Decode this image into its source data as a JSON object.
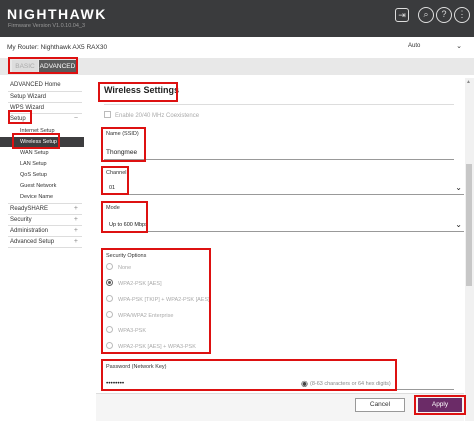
{
  "header": {
    "brand": "NIGHTHAWK",
    "firmware": "Firmware Version V1.0.10.04_3",
    "icons": [
      "logout-icon",
      "search-icon",
      "help-icon",
      "menu-icon"
    ],
    "bg_color": "#3a3b3d"
  },
  "router_bar": {
    "my_router": "My Router: Nighthawk AX5 RAX30",
    "language": "Auto"
  },
  "tabs": {
    "basic": "BASIC",
    "advanced": "ADVANCED"
  },
  "sidebar": {
    "items": [
      {
        "label": "ADVANCED Home"
      },
      {
        "label": "Setup Wizard"
      },
      {
        "label": "WPS Wizard"
      },
      {
        "label": "Setup",
        "expander": "−"
      },
      {
        "label": "Internet Setup"
      },
      {
        "label": "Wireless Setup"
      },
      {
        "label": "WAN Setup"
      },
      {
        "label": "LAN Setup"
      },
      {
        "label": "QoS Setup"
      },
      {
        "label": "Guest Network"
      },
      {
        "label": "Device Name"
      },
      {
        "label": "ReadySHARE",
        "expander": "+"
      },
      {
        "label": "Security",
        "expander": "+"
      },
      {
        "label": "Administration",
        "expander": "+"
      },
      {
        "label": "Advanced Setup",
        "expander": "+"
      }
    ]
  },
  "main": {
    "title": "Wireless Settings",
    "coexistence_label": "Enable 20/40 MHz Coexistence",
    "ssid_label": "Name (SSID)",
    "ssid_value": "Thongmee",
    "channel_label": "Channel",
    "channel_value": "01",
    "mode_label": "Mode",
    "mode_value": "Up to 600 Mbps",
    "security_label": "Security Options",
    "security_options": [
      {
        "label": "None",
        "selected": false
      },
      {
        "label": "WPA2-PSK [AES]",
        "selected": true
      },
      {
        "label": "WPA-PSK [TKIP] + WPA2-PSK [AES]",
        "selected": false
      },
      {
        "label": "WPA/WPA2 Enterprise",
        "selected": false
      },
      {
        "label": "WPA3-PSK",
        "selected": false
      },
      {
        "label": "WPA2-PSK [AES] + WPA3-PSK",
        "selected": false
      }
    ],
    "password_label": "Password (Network Key)",
    "password_value": "••••••••",
    "password_hint": "(8-63 characters or 64 hex digits)"
  },
  "footer": {
    "cancel": "Cancel",
    "apply": "Apply",
    "apply_color": "#6b2b67"
  },
  "highlight_color": "#dd1111"
}
